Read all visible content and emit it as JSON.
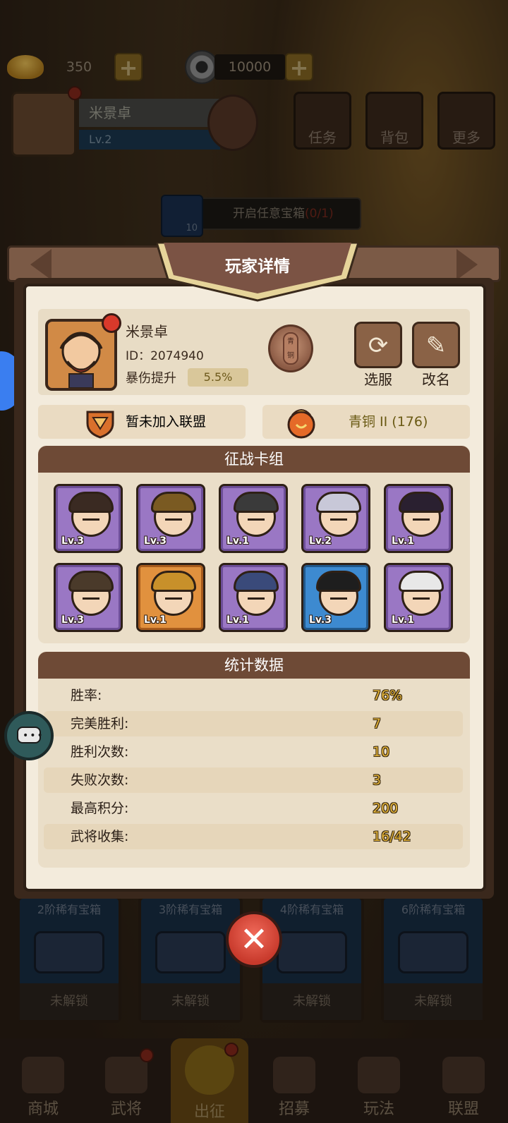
{
  "resources": {
    "gold": "350",
    "coins": "10000",
    "gold_icon": "gold-ingot-icon",
    "coin_icon": "copper-coin-icon"
  },
  "top_player": {
    "name": "米景卓",
    "level": "Lv.2",
    "rank_icon": "bronze-rank-badge"
  },
  "top_buttons": [
    "任务",
    "背包",
    "更多"
  ],
  "quest_banner": {
    "text": "开启任意宝箱",
    "progress": "(0/1)",
    "icon_label": "10"
  },
  "chests": [
    {
      "title": "2阶稀有宝箱",
      "status": "未解锁"
    },
    {
      "title": "3阶稀有宝箱",
      "status": "未解锁"
    },
    {
      "title": "4阶稀有宝箱",
      "status": "未解锁"
    },
    {
      "title": "6阶稀有宝箱",
      "status": "未解锁"
    }
  ],
  "bottom_nav": [
    "商城",
    "武将",
    "出征",
    "招募",
    "玩法",
    "联盟"
  ],
  "dialog": {
    "title": "玩家详情",
    "player": {
      "name": "米景卓",
      "id": "ID：2074940",
      "crit_label": "暴伤提升",
      "crit_value": "5.5%",
      "rank_medal_text": "青铜"
    },
    "buttons": {
      "switch_server": "选服",
      "rename": "改名"
    },
    "alliance_text": "暂未加入联盟",
    "league_text": "青铜 II (176)",
    "deck_title": "征战卡组",
    "cards": [
      {
        "level": "Lv.3",
        "rarity": "purple"
      },
      {
        "level": "Lv.3",
        "rarity": "purple"
      },
      {
        "level": "Lv.1",
        "rarity": "purple"
      },
      {
        "level": "Lv.2",
        "rarity": "purple"
      },
      {
        "level": "Lv.1",
        "rarity": "purple"
      },
      {
        "level": "Lv.3",
        "rarity": "purple"
      },
      {
        "level": "Lv.1",
        "rarity": "orange"
      },
      {
        "level": "Lv.1",
        "rarity": "purple"
      },
      {
        "level": "Lv.3",
        "rarity": "blue"
      },
      {
        "level": "Lv.1",
        "rarity": "purple"
      }
    ],
    "stats_title": "统计数据",
    "stats": [
      {
        "label": "胜率:",
        "value": "76%"
      },
      {
        "label": "完美胜利:",
        "value": "7"
      },
      {
        "label": "胜利次数:",
        "value": "10"
      },
      {
        "label": "失败次数:",
        "value": "3"
      },
      {
        "label": "最高积分:",
        "value": "200"
      },
      {
        "label": "武将收集:",
        "value": "16/42"
      }
    ]
  },
  "colors": {
    "panel_bg": "#f3ebdc",
    "header_brown": "#6e4a36",
    "value_gold": "#e3b33a",
    "close_red": "#d9392b"
  }
}
